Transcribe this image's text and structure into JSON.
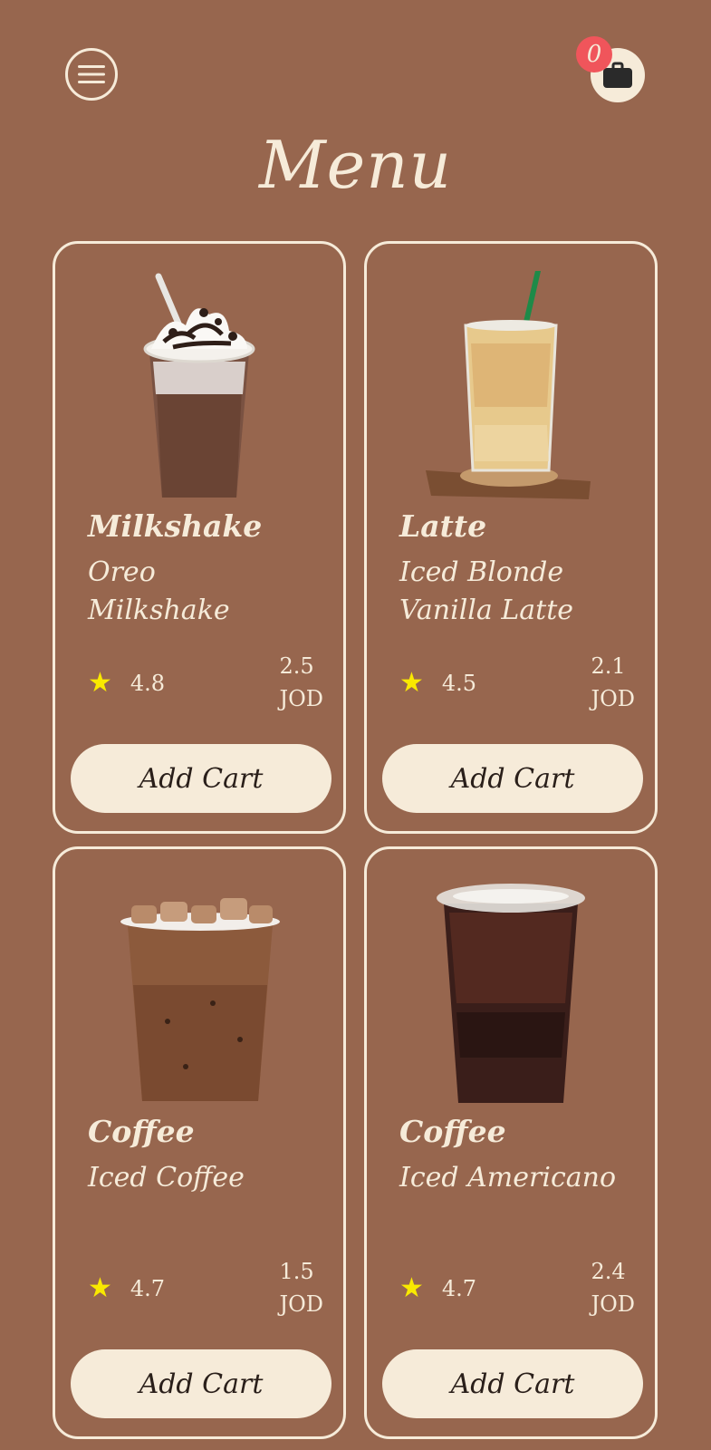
{
  "header": {
    "menu_icon": "hamburger-icon",
    "cart_icon": "shopping-bag-icon",
    "cart_count": "0",
    "title": "Menu"
  },
  "products": [
    {
      "name": "Milkshake",
      "description": "Oreo Milkshake",
      "rating": "4.8",
      "price": "2.5",
      "currency": "JOD",
      "button_label": "Add Cart",
      "image": "oreo-milkshake-image"
    },
    {
      "name": "Latte",
      "description": "Iced Blonde Vanilla Latte",
      "rating": "4.5",
      "price": "2.1",
      "currency": "JOD",
      "button_label": "Add Cart",
      "image": "iced-latte-image"
    },
    {
      "name": "Coffee",
      "description": "Iced Coffee",
      "rating": "4.7",
      "price": "1.5",
      "currency": "JOD",
      "button_label": "Add Cart",
      "image": "iced-coffee-image"
    },
    {
      "name": "Coffee",
      "description": "Iced Americano",
      "rating": "4.7",
      "price": "2.4",
      "currency": "JOD",
      "button_label": "Add Cart",
      "image": "iced-americano-image"
    }
  ],
  "colors": {
    "background": "#97664E",
    "cream": "#F6EBD9",
    "badge": "#F0555B",
    "star": "#F9E900"
  }
}
